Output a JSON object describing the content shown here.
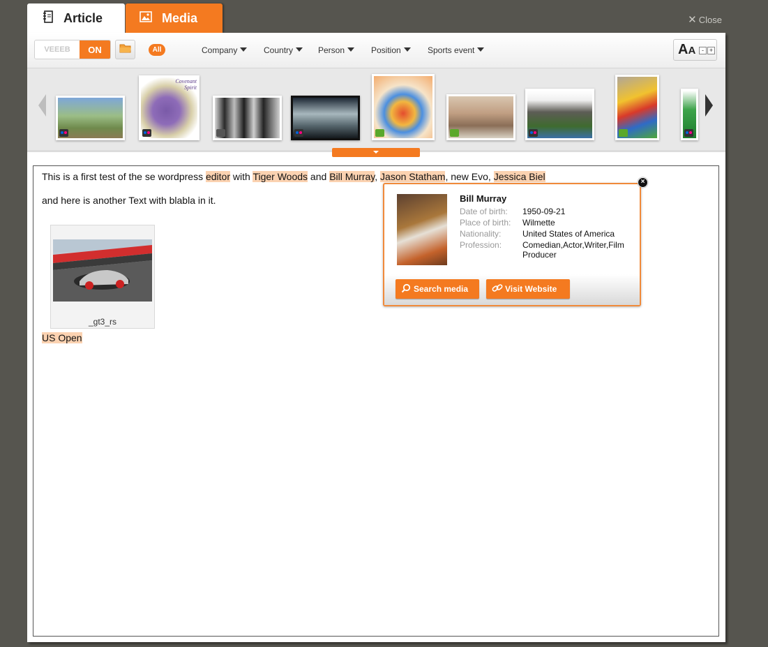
{
  "tabs": {
    "article": "Article",
    "media": "Media"
  },
  "close_label": "Close",
  "toolbar": {
    "toggle_off": "VEEEB",
    "toggle_on": "ON",
    "all_label": "All",
    "filters": [
      "Company",
      "Country",
      "Person",
      "Position",
      "Sports event"
    ]
  },
  "carousel": {
    "thumbnails": [
      {
        "source": "flickr"
      },
      {
        "source": "flickr",
        "caption": "Covenant Spirit"
      },
      {
        "source": "gray"
      },
      {
        "source": "flickr"
      },
      {
        "source": "green"
      },
      {
        "source": "green"
      },
      {
        "source": "flickr"
      },
      {
        "source": "green"
      },
      {
        "source": "flickr"
      }
    ]
  },
  "article": {
    "p1": {
      "s1": "This is a first test of the se wordpress ",
      "h1": "editor",
      "s2": " with ",
      "h2": "Tiger Woods",
      "s3": " and ",
      "h3": "Bill Murray",
      "s4": ", ",
      "h4": "Jason Statham",
      "s5": ", new Evo, ",
      "h5": "Jessica Biel"
    },
    "p2": "and here is another Text with blabla in it.",
    "image_caption": "_gt3_rs",
    "p3_highlight": "US Open"
  },
  "popup": {
    "name": "Bill Murray",
    "fields": [
      {
        "label": "Date of birth:",
        "value": "1950-09-21"
      },
      {
        "label": "Place of birth:",
        "value": "Wilmette"
      },
      {
        "label": "Nationality:",
        "value": "United States of America"
      },
      {
        "label": "Profession:",
        "value": "Comedian,Actor,Writer,Film Producer"
      }
    ],
    "search_button": "Search media",
    "visit_button": "Visit Website",
    "close_symbol": "×"
  },
  "colors": {
    "accent": "#f47a20",
    "highlight": "#fbd2b1",
    "background": "#56554f"
  }
}
